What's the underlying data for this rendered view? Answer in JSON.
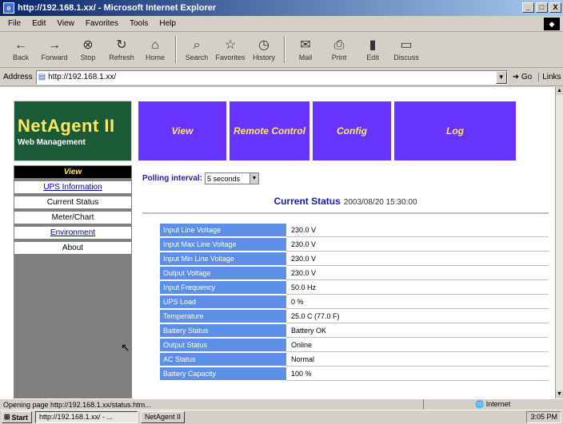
{
  "window": {
    "title": "http://192.168.1.xx/ - Microsoft Internet Explorer",
    "controls": [
      "_",
      "□",
      "X"
    ]
  },
  "menubar": {
    "items": [
      "File",
      "Edit",
      "View",
      "Favorites",
      "Tools",
      "Help"
    ]
  },
  "toolbar": {
    "buttons": [
      {
        "icon": "back-arrow",
        "label": "Back"
      },
      {
        "icon": "forward-arrow",
        "label": "Forward"
      },
      {
        "icon": "stop",
        "label": "Stop"
      },
      {
        "icon": "refresh",
        "label": "Refresh"
      },
      {
        "icon": "home",
        "label": "Home"
      },
      {
        "icon": "search",
        "label": "Search"
      },
      {
        "icon": "favorites",
        "label": "Favorites"
      },
      {
        "icon": "history",
        "label": "History"
      },
      {
        "icon": "mail",
        "label": "Mail"
      },
      {
        "icon": "print",
        "label": "Print"
      },
      {
        "icon": "edit",
        "label": "Edit"
      },
      {
        "icon": "discuss",
        "label": "Discuss"
      }
    ]
  },
  "address": {
    "label": "Address",
    "value": "http://192.168.1.xx/",
    "go": "Go",
    "links": "Links"
  },
  "logo": {
    "brand": "NetAgent II",
    "subtitle": "Web Management"
  },
  "topnav": [
    "View",
    "Remote Control",
    "Config",
    "Log"
  ],
  "leftnav": {
    "items": [
      {
        "label": "View",
        "style": "active"
      },
      {
        "label": "UPS Information",
        "style": "link"
      },
      {
        "label": "Current Status",
        "style": "plain"
      },
      {
        "label": "Meter/Chart",
        "style": "plain"
      },
      {
        "label": "Environment",
        "style": "link"
      },
      {
        "label": "About",
        "style": "plain"
      }
    ]
  },
  "polling": {
    "label": "Polling interval:",
    "selected": "5 seconds"
  },
  "status": {
    "title": "Current Status",
    "datetime": "2003/08/20 15:30:00"
  },
  "status_rows": [
    {
      "label": "Input Line Voltage",
      "value": "230.0 V"
    },
    {
      "label": "Input Max Line Voltage",
      "value": "230.0 V"
    },
    {
      "label": "Input Min Line Voltage",
      "value": "230.0 V"
    },
    {
      "label": "Output Voltage",
      "value": "230.0 V"
    },
    {
      "label": "Input Frequency",
      "value": "50.0 Hz"
    },
    {
      "label": "UPS Load",
      "value": "0 %"
    },
    {
      "label": "Temperature",
      "value": "25.0 C (77.0 F)"
    },
    {
      "label": "Battery Status",
      "value": "Battery OK"
    },
    {
      "label": "Output Status",
      "value": "Online"
    },
    {
      "label": "AC Status",
      "value": "Normal"
    },
    {
      "label": "Battery Capacity",
      "value": "100 %"
    }
  ],
  "statusbar": {
    "text": "Opening page http://192.168.1.xx/status.htm...",
    "zone": "Internet"
  },
  "taskbar": {
    "start": "Start",
    "active_window": "http://192.168.1.xx/ - ...",
    "other_window": "NetAgent II",
    "tray": "3:05 PM"
  }
}
